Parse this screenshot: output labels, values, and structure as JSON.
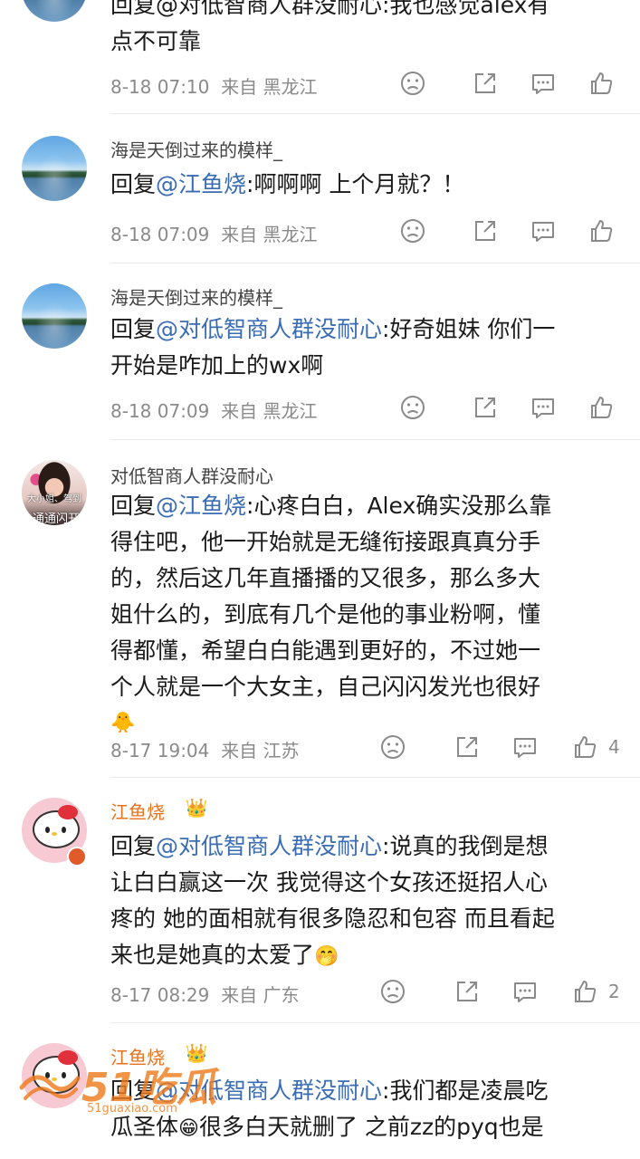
{
  "comments": [
    {
      "text_lines": [
        "回复@对低智商人群没耐心:我也感觉alex有",
        "点不可靠"
      ],
      "date": "8-18 07:10",
      "location": "来自 黑龙江"
    },
    {
      "username": "海是天倒过来的模样_",
      "reply_prefix": "回复",
      "mention": "@江鱼烧",
      "text_rest": ":啊啊啊 上个月就？！",
      "date": "8-18 07:09",
      "location": "来自 黑龙江"
    },
    {
      "username": "海是天倒过来的模样_",
      "reply_prefix": "回复",
      "mention": "@对低智商人群没耐心",
      "text_rest": ":好奇姐妹 你们一",
      "text_line2": "开始是咋加上的wx啊",
      "date": "8-18 07:09",
      "location": "来自 黑龙江"
    },
    {
      "username": "对低智商人群没耐心",
      "avatar_text1": "大小姐、驾到",
      "avatar_text2": "通通闪开",
      "reply_prefix": "回复",
      "mention": "@江鱼烧",
      "text_rest": ":心疼白白，Alex确实没那么靠",
      "text_lines": [
        "得住吧，他一开始就是无缝衔接跟真真分手",
        "的，然后这几年直播播的又很多，那么多大",
        "姐什么的，到底有几个是他的事业粉啊，懂",
        "得都懂，希望白白能遇到更好的，不过她一",
        "个人就是一个大女主，自己闪闪发光也很好"
      ],
      "emoji": "🐥",
      "date": "8-17 19:04",
      "location": "来自 江苏",
      "likes": "4"
    },
    {
      "username": "江鱼烧",
      "badge": "👑",
      "reply_prefix": "回复",
      "mention": "@对低智商人群没耐心",
      "text_rest": ":说真的我倒是想",
      "text_lines": [
        "让白白赢这一次 我觉得这个女孩还挺招人心",
        "疼的 她的面相就有很多隐忍和包容 而且看起"
      ],
      "text_line_last": "来也是她真的太爱了",
      "emoji": "🤭",
      "date": "8-17 08:29",
      "location": "来自 广东",
      "likes": "2"
    },
    {
      "username": "江鱼烧",
      "badge": "👑",
      "reply_prefix": "回复",
      "mention": "@对低智商人群没耐心",
      "text_rest": ":我们都是凌晨吃",
      "text_line2_a": "瓜圣体",
      "emoji": "😁",
      "text_line2_b": "很多白天就删了 之前zz的pyq也是"
    }
  ],
  "watermark": {
    "big": "51吃瓜",
    "small": "51guaxiao.com"
  },
  "icons": [
    "sad-face-icon",
    "share-icon",
    "comment-icon",
    "like-icon"
  ],
  "colors": {
    "mention": "#3a6cb4",
    "meta": "#8a8a8a",
    "vip_name": "#e8721c"
  }
}
